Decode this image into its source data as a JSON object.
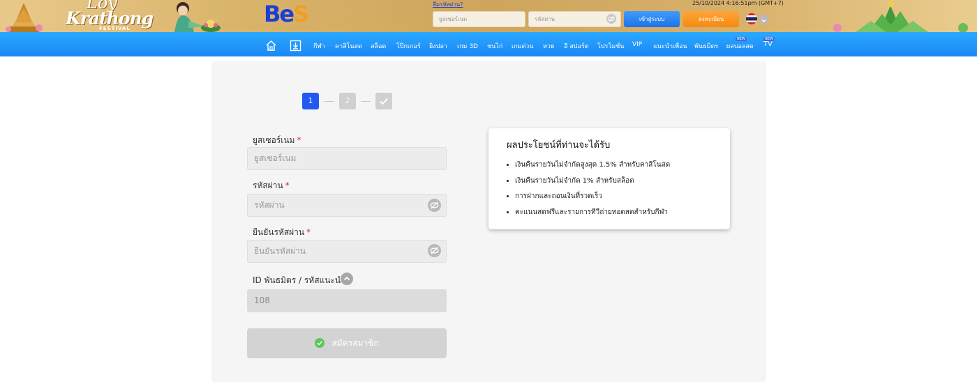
{
  "header": {
    "festival_line1": "Loy",
    "festival_line2": "Krathong",
    "festival_line3": "FESTIVAL",
    "brand_logo_part1": "Be",
    "brand_logo_part2": "S",
    "forgot_password_link": "ลืมรหัสผ่าน?",
    "datetime": "25/10/2024 4:16:51pm (GMT+7)",
    "username_placeholder": "ยูสเซอร์เนม",
    "password_placeholder": "รหัสผ่าน",
    "login_button": "เข้าสู่ระบบ",
    "register_button": "ลงทะเบียน",
    "language": "th"
  },
  "nav": {
    "items": [
      "กีฬา",
      "คาสิโนสด",
      "สล็อต",
      "โป๊กเกอร์",
      "ยิงปลา",
      "เกม 3D",
      "ชนไก่",
      "เกมด่วน",
      "หวย",
      "อี สปอร์ต",
      "โปรโมชั่น",
      "VIP",
      "แนะนำเพื่อน",
      "พันธมิตร",
      "ผลบอลสด",
      "TV"
    ],
    "new_badge": "NEW"
  },
  "steps": {
    "step1": "1",
    "step2": "2",
    "active_step": 1
  },
  "form": {
    "username_label": "ยูสเซอร์เนม",
    "username_placeholder": "ยูสเซอร์เนม",
    "password_label": "รหัสผ่าน",
    "password_placeholder": "รหัสผ่าน",
    "confirm_label": "ยืนยันรหัสผ่าน",
    "confirm_placeholder": "ยืนยันรหัสผ่าน",
    "referral_label": "ID พันธมิตร / รหัสแนะนำ",
    "referral_value": "108",
    "required_mark": "*",
    "submit_label": "สมัครสมาชิก"
  },
  "benefits": {
    "title": "ผลประโยชน์ที่ท่านจะได้รับ",
    "items": [
      "เงินคืนรายวันไม่จำกัดสูงสุด 1.5% สำหรับคาสิโนสด",
      "เงินคืนรายวันไม่จำกัด 1% สำหรับสล็อต",
      "การฝากและถอนเงินที่รวดเร็ว",
      "คะแนนสดฟรีและรายการทีวีถ่ายทอดสดสำหรับกีฬา"
    ]
  },
  "colors": {
    "nav_blue": "#1b88f6",
    "step_active": "#2259f0",
    "login_blue": "#1e74e8",
    "register_orange": "#f58a10",
    "required_red": "#e0201a",
    "submit_check_green": "#5ac85a"
  }
}
